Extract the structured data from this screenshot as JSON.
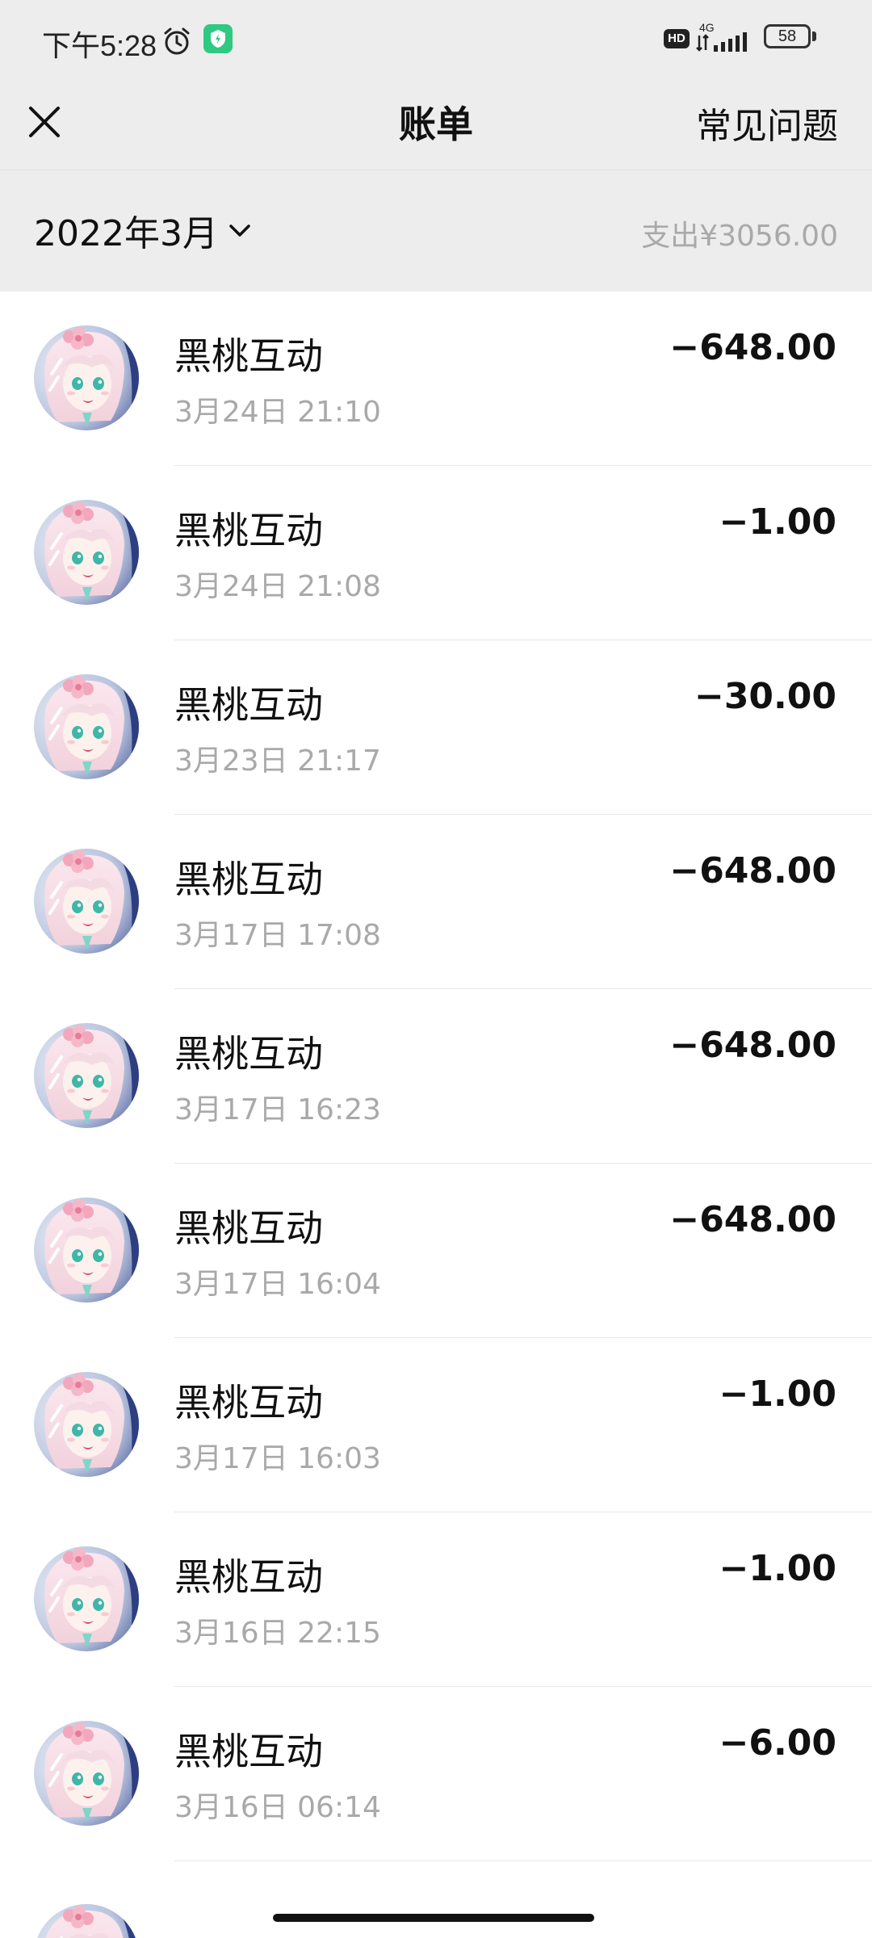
{
  "status_bar": {
    "time": "下午5:28",
    "network": "4G",
    "hd": "HD",
    "battery": "58"
  },
  "nav": {
    "title": "账单",
    "faq": "常见问题"
  },
  "month_bar": {
    "month": "2022年3月",
    "expense": "支出¥3056.00"
  },
  "bills": [
    {
      "merchant": "黑桃互动",
      "time": "3月24日 21:10",
      "amount": "−648.00"
    },
    {
      "merchant": "黑桃互动",
      "time": "3月24日 21:08",
      "amount": "−1.00"
    },
    {
      "merchant": "黑桃互动",
      "time": "3月23日 21:17",
      "amount": "−30.00"
    },
    {
      "merchant": "黑桃互动",
      "time": "3月17日 17:08",
      "amount": "−648.00"
    },
    {
      "merchant": "黑桃互动",
      "time": "3月17日 16:23",
      "amount": "−648.00"
    },
    {
      "merchant": "黑桃互动",
      "time": "3月17日 16:04",
      "amount": "−648.00"
    },
    {
      "merchant": "黑桃互动",
      "time": "3月17日 16:03",
      "amount": "−1.00"
    },
    {
      "merchant": "黑桃互动",
      "time": "3月16日 22:15",
      "amount": "−1.00"
    },
    {
      "merchant": "黑桃互动",
      "time": "3月16日 06:14",
      "amount": "−6.00"
    }
  ],
  "colors": {
    "background_gray": "#ededed",
    "secondary_text": "#a9a9a9",
    "primary_text": "#111111",
    "app_icon_green": "#2fc982"
  },
  "icons": {
    "close": "close-icon",
    "chevron": "chevron-down-icon",
    "alarm": "alarm-icon",
    "signal": "signal-icon",
    "battery": "battery-icon"
  }
}
